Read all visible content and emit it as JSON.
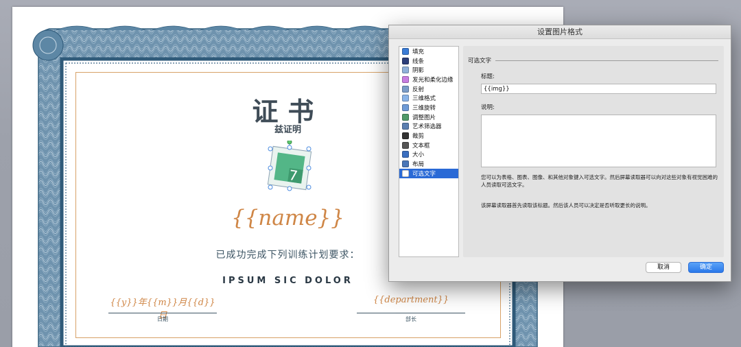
{
  "certificate": {
    "title": "证书",
    "subtitle": "兹证明",
    "logo_digit": "7",
    "name_placeholder": "{{name}}",
    "complete_text": "已成功完成下列训练计划要求：",
    "course": "IPSUM SIC DOLOR",
    "date_placeholder": "{{y}}年{{m}}月{{d}}日",
    "date_label": "日期",
    "department_placeholder": "{{department}}",
    "department_label": "部长"
  },
  "dialog": {
    "title": "设置图片格式",
    "categories": [
      {
        "label": "填充",
        "icon": "paint-bucket-icon",
        "color": "#3a7bd5"
      },
      {
        "label": "线条",
        "icon": "line-icon",
        "color": "#2c3e7a"
      },
      {
        "label": "阴影",
        "icon": "shadow-icon",
        "color": "#8fb0d9"
      },
      {
        "label": "发光和柔化边缘",
        "icon": "glow-icon",
        "color": "#c77de0"
      },
      {
        "label": "反射",
        "icon": "reflection-icon",
        "color": "#7a9cc8"
      },
      {
        "label": "三维格式",
        "icon": "3d-format-icon",
        "color": "#8ab4e8"
      },
      {
        "label": "三维旋转",
        "icon": "3d-rotation-icon",
        "color": "#6d9ad6"
      },
      {
        "label": "调整图片",
        "icon": "adjust-picture-icon",
        "color": "#4f9a6a"
      },
      {
        "label": "艺术筛选器",
        "icon": "artistic-filter-icon",
        "color": "#5b7fb0"
      },
      {
        "label": "裁剪",
        "icon": "crop-icon",
        "color": "#333333"
      },
      {
        "label": "文本框",
        "icon": "text-box-icon",
        "color": "#555555"
      },
      {
        "label": "大小",
        "icon": "size-icon",
        "color": "#3a6fc0"
      },
      {
        "label": "布局",
        "icon": "layout-icon",
        "color": "#4a76b8"
      },
      {
        "label": "可选文字",
        "icon": "alt-text-icon",
        "color": "#ffffff"
      }
    ],
    "selected_index": 13,
    "section_title": "可选文字",
    "title_label": "标题:",
    "title_value": "{{img}}",
    "description_label": "说明:",
    "description_value": "",
    "help_text_1": "您可以为表格、图表、图像、和其他对象键入可选文字。然后屏幕读取器可以向对这些对象有视觉困难的人员读取可选文字。",
    "help_text_2": "该屏幕读取器首先读取该标题。然后该人员可以决定是否听取更长的说明。",
    "cancel_label": "取消",
    "ok_label": "确定"
  },
  "colors": {
    "border_blue": "#4b7594",
    "name_orange": "#cf8646",
    "inner_frame": "#d7a166",
    "selection": "#2a6ad6",
    "logo_green": "#53b687"
  }
}
